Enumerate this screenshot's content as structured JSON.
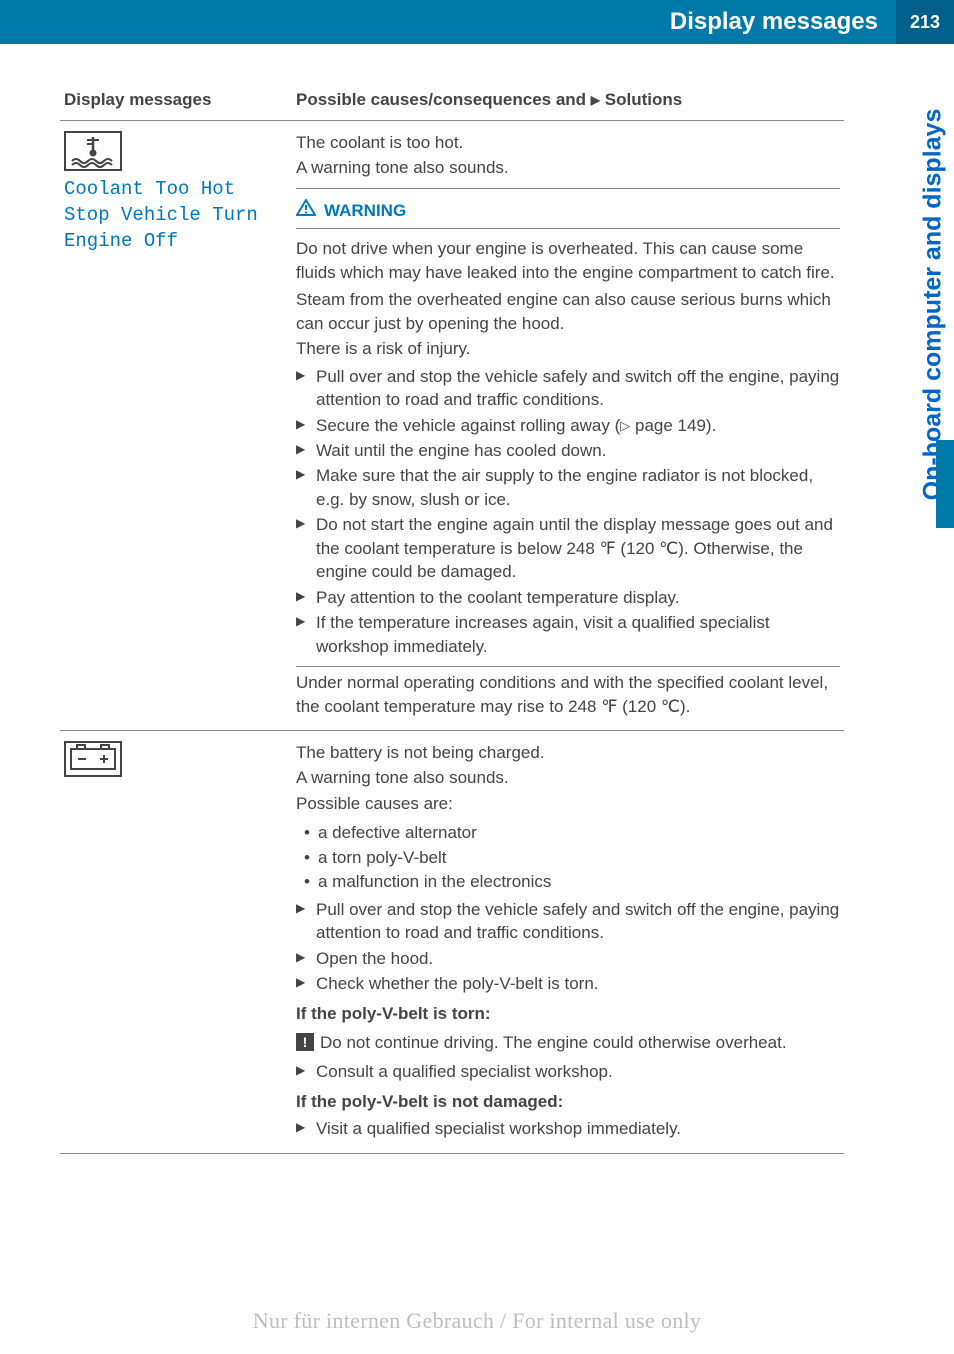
{
  "header": {
    "title": "Display messages",
    "page": "213"
  },
  "side_tab": "On-board computer and displays",
  "table": {
    "col1": "Display messages",
    "col2_a": "Possible causes/consequences and ",
    "col2_b": " Solutions"
  },
  "row1": {
    "msg_line1": "Coolant Too Hot",
    "msg_line2": "Stop Vehicle Turn",
    "msg_line3": "Engine Off",
    "intro1": "The coolant is too hot.",
    "intro2": "A warning tone also sounds.",
    "warn_label": "WARNING",
    "warn_p1": "Do not drive when your engine is overheated. This can cause some fluids which may have leaked into the engine compartment to catch fire.",
    "warn_p2": "Steam from the overheated engine can also cause serious burns which can occur just by opening the hood.",
    "warn_p3": "There is a risk of injury.",
    "s1": "Pull over and stop the vehicle safely and switch off the engine, paying attention to road and traffic conditions.",
    "s2a": "Secure the vehicle against rolling away (",
    "s2b": " page 149).",
    "s3": "Wait until the engine has cooled down.",
    "s4": "Make sure that the air supply to the engine radiator is not blocked, e.g. by snow, slush or ice.",
    "s5": "Do not start the engine again until the display message goes out and the coolant temperature is below 248 ℉ (120 ℃). Otherwise, the engine could be damaged.",
    "s6": "Pay attention to the coolant temperature display.",
    "s7": "If the temperature increases again, visit a qualified specialist workshop immediately.",
    "outro": "Under normal operating conditions and with the specified coolant level, the coolant temperature may rise to 248 ℉ (120 ℃)."
  },
  "row2": {
    "intro1": "The battery is not being charged.",
    "intro2": "A warning tone also sounds.",
    "intro3": "Possible causes are:",
    "c1": "a defective alternator",
    "c2": "a torn poly-V-belt",
    "c3": "a malfunction in the electronics",
    "s1": "Pull over and stop the vehicle safely and switch off the engine, paying attention to road and traffic conditions.",
    "s2": "Open the hood.",
    "s3": "Check whether the poly-V-belt is torn.",
    "h1": "If the poly-V-belt is torn:",
    "bang": "Do not continue driving. The engine could otherwise overheat.",
    "s4": "Consult a qualified specialist workshop.",
    "h2": "If the poly-V-belt is not damaged:",
    "s5": "Visit a qualified specialist workshop immediately."
  },
  "watermark": "Nur für internen Gebrauch / For internal use only"
}
